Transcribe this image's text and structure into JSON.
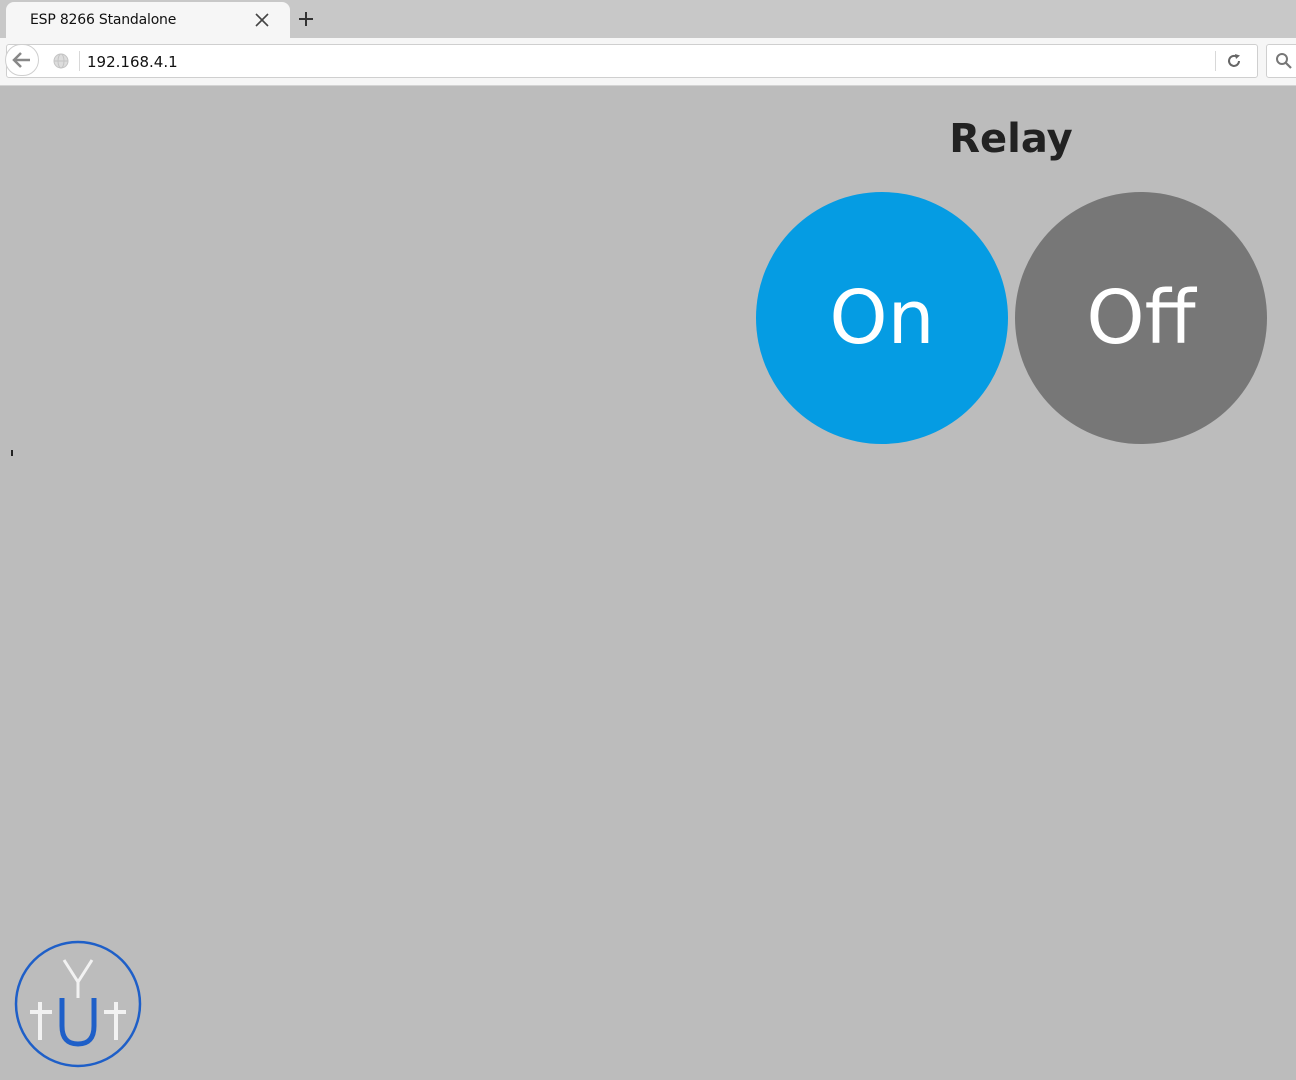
{
  "browser": {
    "tab_title": "ESP 8266 Standalone",
    "url": "192.168.4.1",
    "icons": {
      "tab_close": "close-icon",
      "new_tab": "plus-icon",
      "back": "back-arrow-icon",
      "site_info": "globe-icon",
      "reload": "reload-icon",
      "search": "search-icon"
    }
  },
  "page": {
    "title": "Relay",
    "buttons": {
      "on_label": "On",
      "off_label": "Off"
    },
    "colors": {
      "background": "#bcbcbc",
      "on": "#059ce3",
      "off": "#777777"
    }
  },
  "watermark": {
    "letters": "YUtt",
    "color": "#1e5fc8"
  }
}
